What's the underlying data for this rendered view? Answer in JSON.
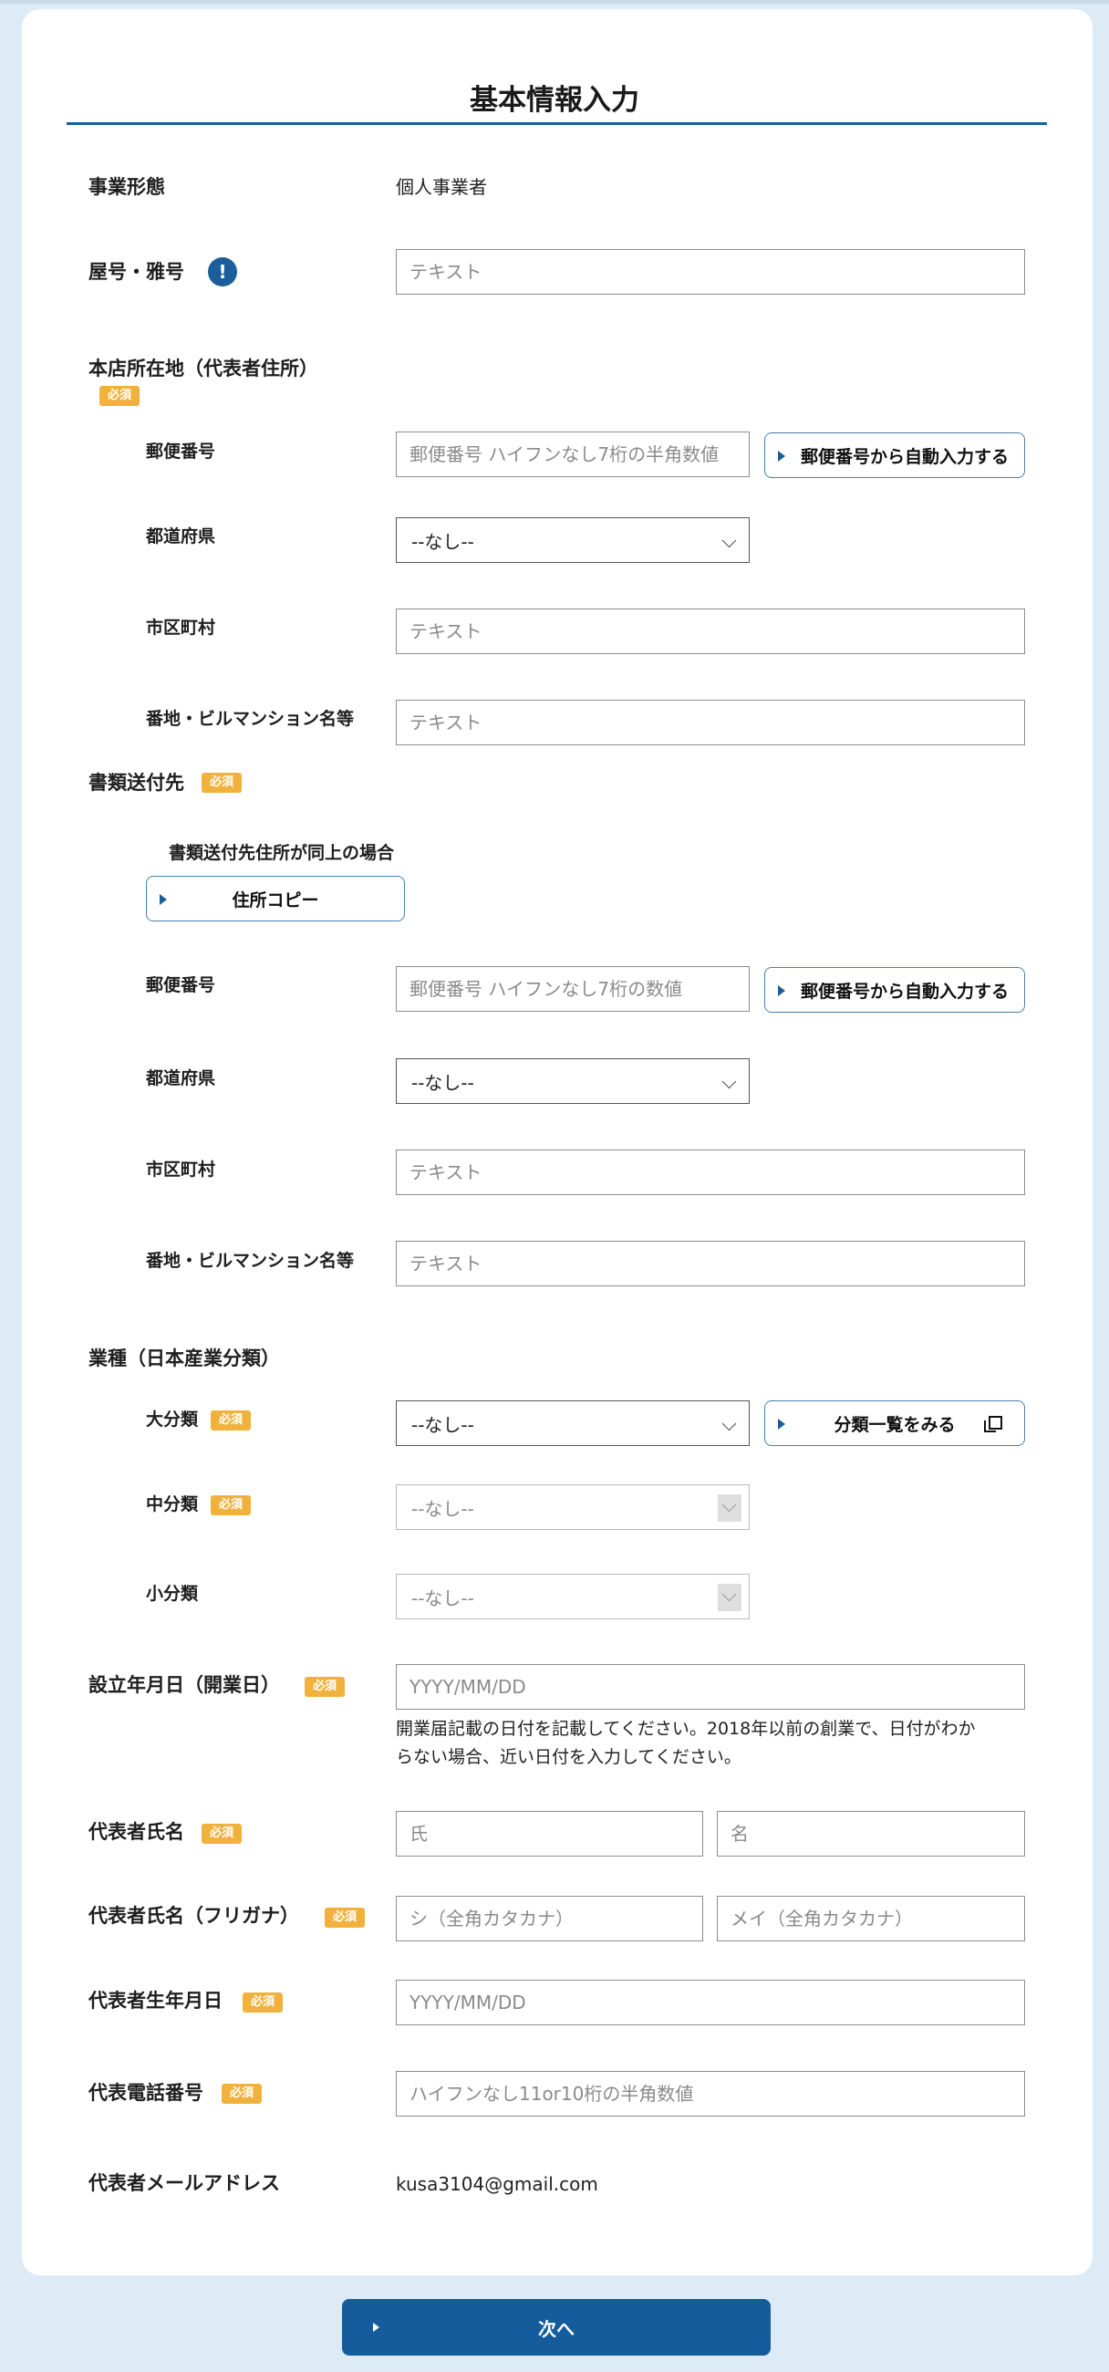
{
  "page": {
    "title": "基本情報入力"
  },
  "required_badge": "必須",
  "business_type": {
    "label": "事業形態",
    "value": "個人事業者"
  },
  "trade_name": {
    "label": "屋号・雅号",
    "placeholder": "テキスト"
  },
  "head_office": {
    "label": "本店所在地（代表者住所）",
    "postal_label": "郵便番号",
    "postal_placeholder": "郵便番号 ハイフンなし7桁の半角数値",
    "autofill_label": "郵便番号から自動入力する",
    "prefecture_label": "都道府県",
    "prefecture_value": "--なし--",
    "city_label": "市区町村",
    "city_placeholder": "テキスト",
    "street_label": "番地・ビルマンション名等",
    "street_placeholder": "テキスト"
  },
  "mailing": {
    "label": "書類送付先",
    "copy_hint": "書類送付先住所が同上の場合",
    "copy_button": "住所コピー",
    "postal_label": "郵便番号",
    "postal_placeholder": "郵便番号 ハイフンなし7桁の数値",
    "autofill_label": "郵便番号から自動入力する",
    "prefecture_label": "都道府県",
    "prefecture_value": "--なし--",
    "city_label": "市区町村",
    "city_placeholder": "テキスト",
    "street_label": "番地・ビルマンション名等",
    "street_placeholder": "テキスト"
  },
  "industry": {
    "label": "業種（日本産業分類）",
    "major_label": "大分類",
    "major_value": "--なし--",
    "list_button": "分類一覧をみる",
    "medium_label": "中分類",
    "medium_value": "--なし--",
    "minor_label": "小分類",
    "minor_value": "--なし--"
  },
  "established": {
    "label": "設立年月日（開業日）",
    "placeholder": "YYYY/MM/DD",
    "note_line1": "開業届記載の日付を記載してください。2018年以前の創業で、日付がわか",
    "note_line2": "らない場合、近い日付を入力してください。"
  },
  "rep_name": {
    "label": "代表者氏名",
    "last_placeholder": "氏",
    "first_placeholder": "名"
  },
  "rep_kana": {
    "label": "代表者氏名（フリガナ）",
    "last_placeholder": "シ（全角カタカナ）",
    "first_placeholder": "メイ（全角カタカナ）"
  },
  "rep_birth": {
    "label": "代表者生年月日",
    "placeholder": "YYYY/MM/DD"
  },
  "rep_phone": {
    "label": "代表電話番号",
    "placeholder": "ハイフンなし11or10桁の半角数値"
  },
  "rep_email": {
    "label": "代表者メールアドレス",
    "value": "kusa3104@gmail.com"
  },
  "next_button": "次へ",
  "colors": {
    "accent": "#1a5f99",
    "badge": "#f0b23c",
    "background": "#dcebf5"
  }
}
